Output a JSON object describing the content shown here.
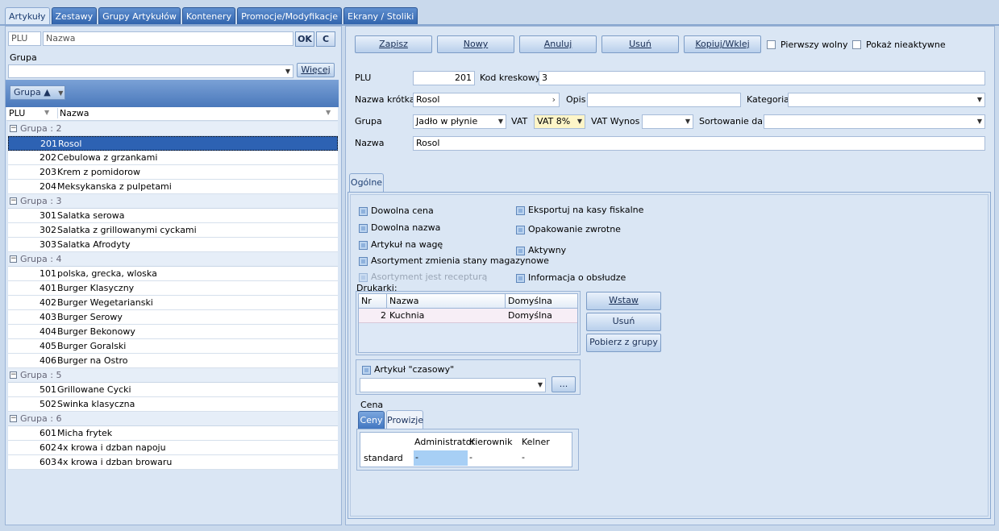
{
  "top_tabs": [
    "Artykuły",
    "Zestawy",
    "Grupy Artykułów",
    "Kontenery",
    "Promocje/Modyfikacje",
    "Ekrany / Stoliki"
  ],
  "left": {
    "plu_placeholder": "PLU",
    "name_placeholder": "Nazwa",
    "ok_label": "OK",
    "c_label": "C",
    "group_label": "Grupa",
    "more_label": "Więcej",
    "group_chip": "Grupa ▲",
    "col_plu": "PLU",
    "col_name": "Nazwa",
    "groups": [
      {
        "title": "Grupa : 2",
        "items": [
          {
            "plu": "201",
            "name": "Rosol",
            "selected": true
          },
          {
            "plu": "202",
            "name": "Cebulowa z grzankami"
          },
          {
            "plu": "203",
            "name": "Krem z pomidorow"
          },
          {
            "plu": "204",
            "name": "Meksykanska z pulpetami"
          }
        ]
      },
      {
        "title": "Grupa : 3",
        "items": [
          {
            "plu": "301",
            "name": "Salatka serowa"
          },
          {
            "plu": "302",
            "name": "Salatka z grillowanymi cyckami"
          },
          {
            "plu": "303",
            "name": "Salatka Afrodyty"
          }
        ]
      },
      {
        "title": "Grupa : 4",
        "items": [
          {
            "plu": "101",
            "name": "polska, grecka, wloska"
          },
          {
            "plu": "401",
            "name": "Burger Klasyczny"
          },
          {
            "plu": "402",
            "name": "Burger Wegetarianski"
          },
          {
            "plu": "403",
            "name": "Burger Serowy"
          },
          {
            "plu": "404",
            "name": "Burger Bekonowy"
          },
          {
            "plu": "405",
            "name": "Burger Goralski"
          },
          {
            "plu": "406",
            "name": "Burger na Ostro"
          }
        ]
      },
      {
        "title": "Grupa : 5",
        "items": [
          {
            "plu": "501",
            "name": "Grillowane Cycki"
          },
          {
            "plu": "502",
            "name": "Swinka klasyczna"
          }
        ]
      },
      {
        "title": "Grupa : 6",
        "items": [
          {
            "plu": "601",
            "name": "Micha frytek"
          },
          {
            "plu": "602",
            "name": "4x krowa i dzban napoju"
          },
          {
            "plu": "603",
            "name": "4x krowa i dzban browaru"
          }
        ]
      }
    ]
  },
  "toolbar": {
    "save": "Zapisz",
    "new": "Nowy",
    "cancel": "Anuluj",
    "delete": "Usuń",
    "copy": "Kopiuj/Wklej",
    "first_free": "Pierwszy wolny",
    "show_inactive": "Pokaż nieaktywne"
  },
  "form": {
    "plu_label": "PLU",
    "plu_value": "201",
    "barcode_label": "Kod kreskowy",
    "barcode_value": "3",
    "short_name_label": "Nazwa krótka",
    "short_name_value": "Rosol",
    "short_name_arrow": "›",
    "desc_label": "Opis",
    "desc_value": "",
    "category_label": "Kategoria",
    "category_value": "",
    "group_label": "Grupa",
    "group_value": "Jadło w płynie",
    "vat_label": "VAT",
    "vat_value": "VAT 8%",
    "vat_takeaway_label": "VAT Wynos",
    "vat_takeaway_value": "",
    "sort_label": "Sortowanie dań",
    "sort_value": "",
    "name_label": "Nazwa",
    "name_value": "Rosol"
  },
  "general_tab": "Ogólne",
  "options_left": [
    {
      "label": "Dowolna cena",
      "disabled": false
    },
    {
      "label": "Dowolna nazwa",
      "disabled": false
    },
    {
      "label": "Artykuł na wagę",
      "disabled": false
    },
    {
      "label": "Asortyment zmienia stany magazynowe",
      "disabled": false
    },
    {
      "label": "Asortyment jest recepturą",
      "disabled": true
    }
  ],
  "options_right": [
    "Eksportuj na kasy fiskalne",
    "Opakowanie zwrotne",
    "Aktywny",
    "Informacja o obsłudze"
  ],
  "printers": {
    "label": "Drukarki:",
    "col_nr": "Nr",
    "col_name": "Nazwa",
    "col_default": "Domyślna",
    "rows": [
      {
        "nr": "2",
        "name": "Kuchnia",
        "default": "Domyślna"
      }
    ],
    "insert": "Wstaw",
    "delete": "Usuń",
    "from_group": "Pobierz z grupy"
  },
  "timed": {
    "label": "Artykuł \"czasowy\"",
    "value": "",
    "dots": "..."
  },
  "price": {
    "label": "Cena",
    "tab_prices": "Ceny",
    "tab_fees": "Prowizje",
    "cols": [
      "Administrator",
      "Kierownik",
      "Kelner"
    ],
    "row_label": "standard",
    "values": [
      "-",
      "-",
      "-"
    ]
  }
}
